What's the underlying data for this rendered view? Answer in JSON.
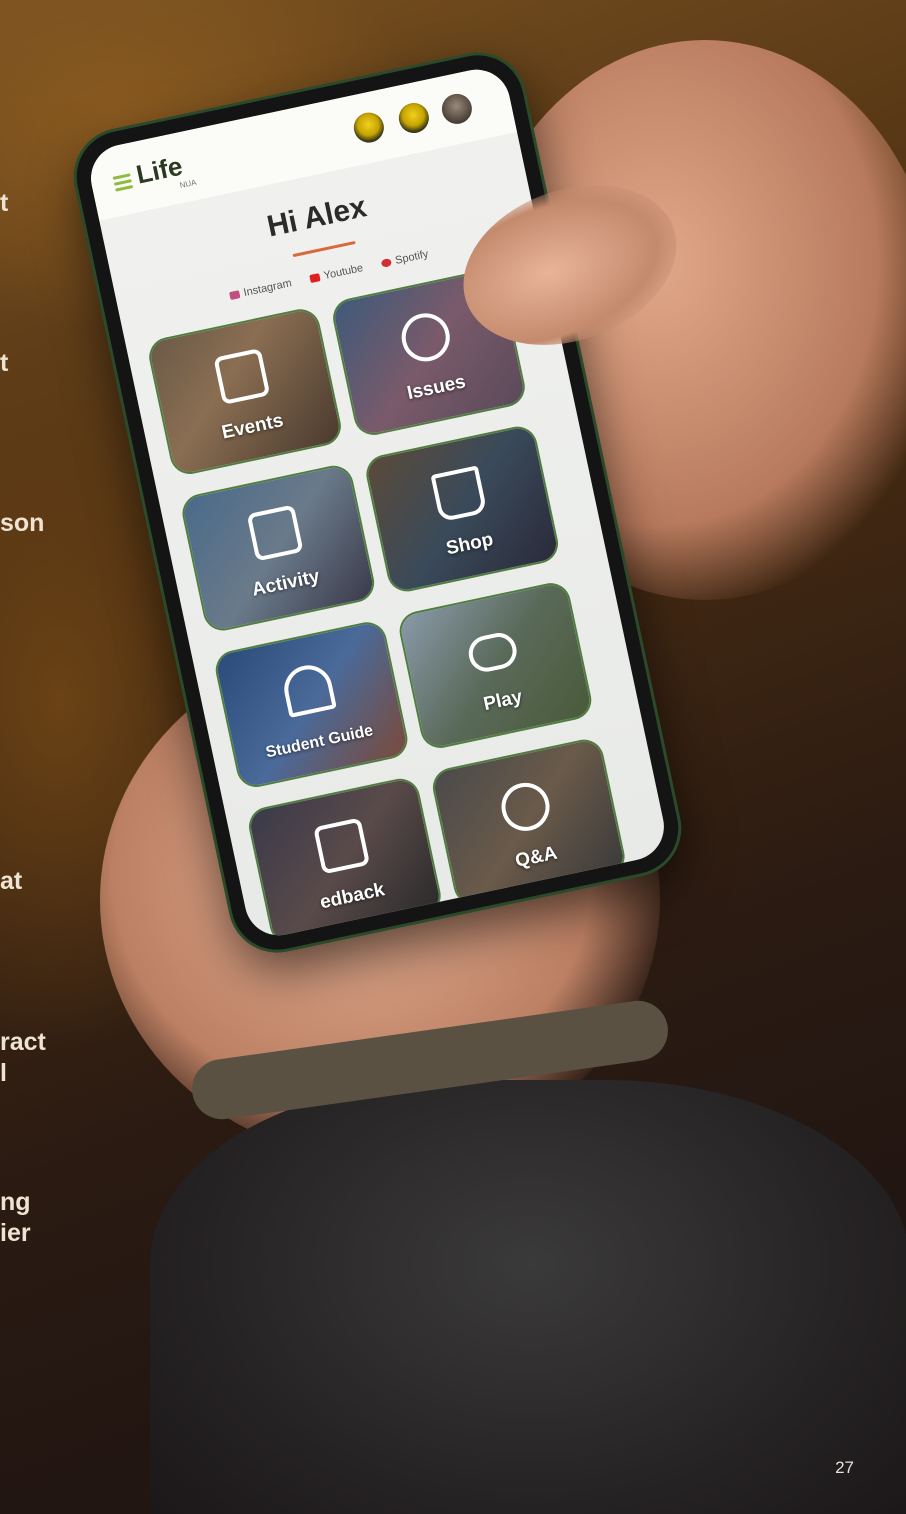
{
  "page": {
    "number": "27"
  },
  "left_fragments": [
    "t",
    "t",
    "son",
    "at",
    "ract\nl",
    "ng\nier"
  ],
  "app": {
    "title": "Life",
    "subtitle": "NUA",
    "greeting": "Hi Alex",
    "social": [
      "Instagram",
      "Youtube",
      "Spotify"
    ],
    "tiles": [
      {
        "label": "Events",
        "icon": "calendar-check-icon"
      },
      {
        "label": "Issues",
        "icon": "handshake-icon"
      },
      {
        "label": "Activity",
        "icon": "id-card-icon"
      },
      {
        "label": "Shop",
        "icon": "shopping-cart-icon"
      },
      {
        "label": "Student Guide",
        "icon": "building-icon"
      },
      {
        "label": "Play",
        "icon": "gamepad-icon"
      },
      {
        "label": "edback",
        "icon": "clipboard-list-icon"
      },
      {
        "label": "Q&A",
        "icon": "question-icon"
      }
    ]
  },
  "colors": {
    "accent": "#8fbc3c",
    "tile_border": "#4f7d3f",
    "underline": "#d66a3a"
  }
}
